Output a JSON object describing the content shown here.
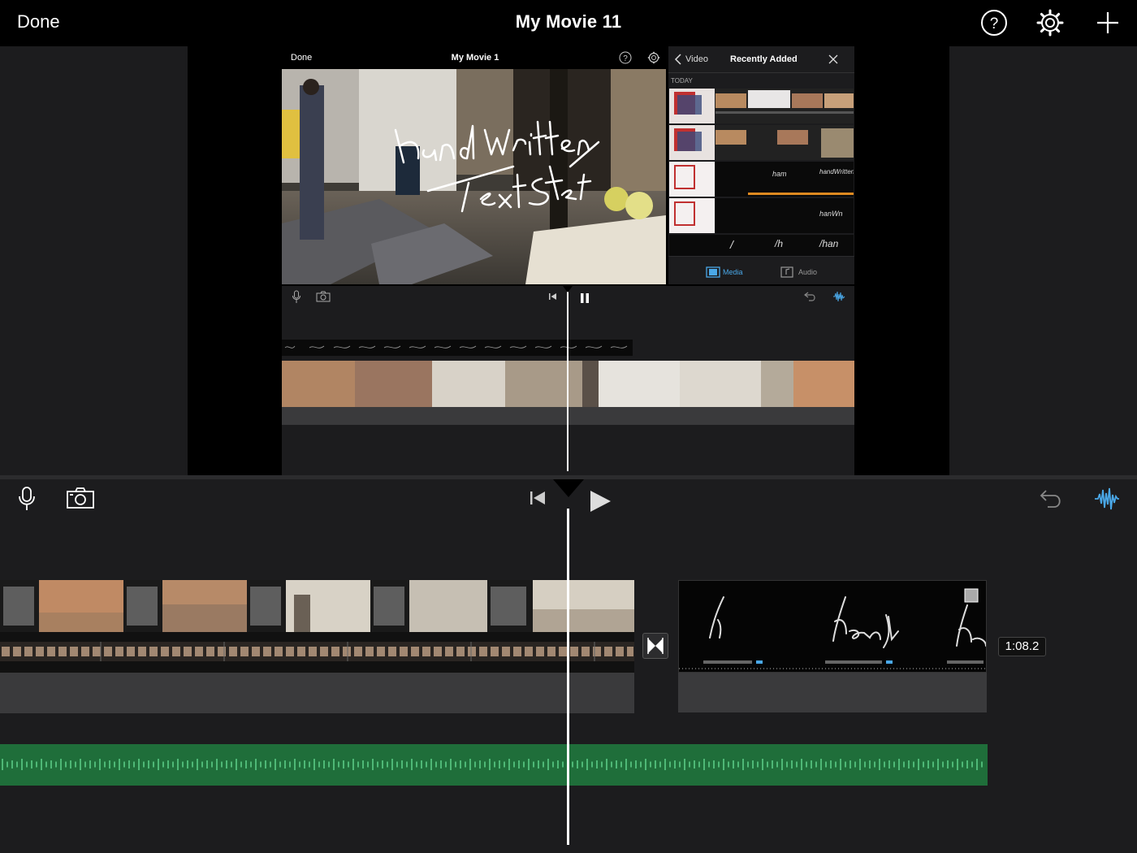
{
  "topbar": {
    "done_label": "Done",
    "title": "My Movie 11",
    "icons": [
      "help-icon",
      "settings-gear-icon",
      "add-plus-icon"
    ]
  },
  "inner_preview": {
    "done_label": "Done",
    "title": "My Movie 1",
    "video_overlay_text": "hand Written Text Start"
  },
  "media_browser": {
    "back_label": "Video",
    "title": "Recently Added",
    "section_label": "TODAY",
    "tabs": [
      {
        "label": "Media",
        "active": true
      },
      {
        "label": "Audio",
        "active": false
      }
    ]
  },
  "main_timeline": {
    "clip_duration": "1:08.2"
  },
  "colors": {
    "accent_blue": "#4aa8e8",
    "audio_green": "#1f6e3a",
    "audio_wave": "#5fd08a",
    "panel": "#1c1c1e"
  }
}
